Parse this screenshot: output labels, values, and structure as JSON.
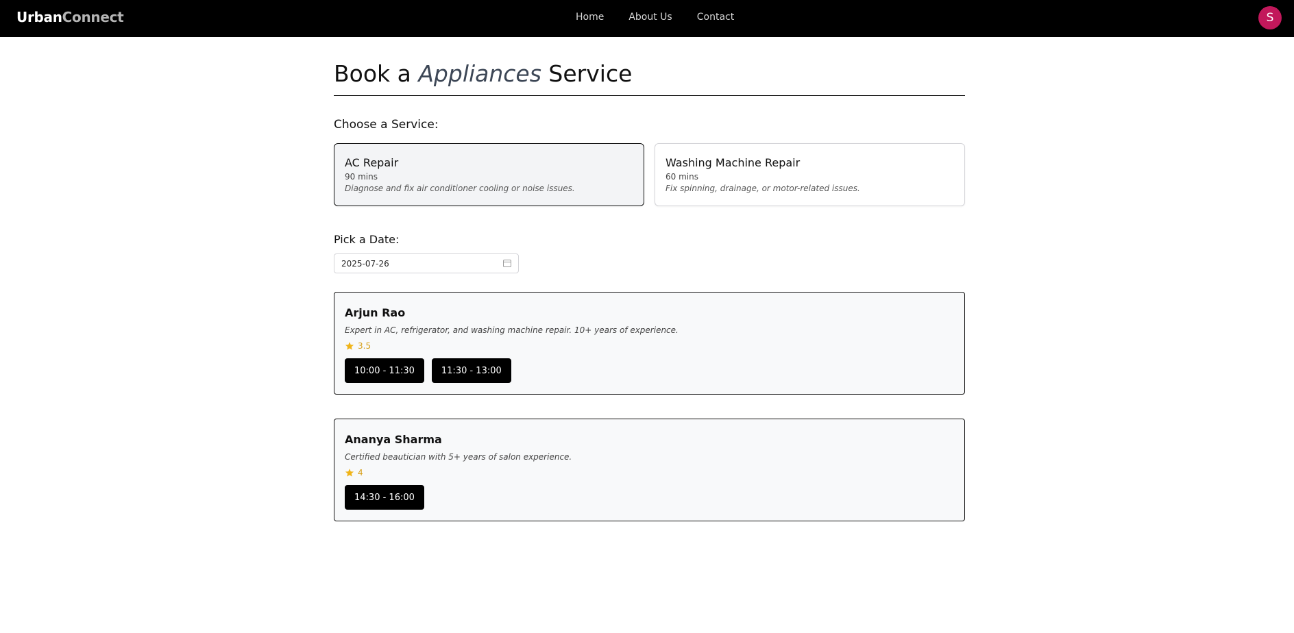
{
  "navbar": {
    "brand_part1": "Urban",
    "brand_part2": "Connect",
    "links": [
      "Home",
      "About Us",
      "Contact"
    ],
    "avatar_initial": "S",
    "avatar_color": "#c2185b"
  },
  "page": {
    "title_prefix": "Book a ",
    "title_category": "Appliances",
    "title_suffix": " Service",
    "choose_label": "Choose a Service:",
    "date_label": "Pick a Date:"
  },
  "services": [
    {
      "name": "AC Repair",
      "duration": "90 mins",
      "description": "Diagnose and fix air conditioner cooling or noise issues.",
      "selected": true
    },
    {
      "name": "Washing Machine Repair",
      "duration": "60 mins",
      "description": "Fix spinning, drainage, or motor-related issues.",
      "selected": false
    }
  ],
  "date": {
    "value": "2025-07-26",
    "icon": "calendar-icon"
  },
  "professionals": [
    {
      "name": "Arjun Rao",
      "bio": "Expert in AC, refrigerator, and washing machine repair. 10+ years of experience.",
      "rating": "3.5",
      "slots": [
        "10:00 - 11:30",
        "11:30 - 13:00"
      ]
    },
    {
      "name": "Ananya Sharma",
      "bio": "Certified beautician with 5+ years of salon experience.",
      "rating": "4",
      "slots": [
        "14:30 - 16:00"
      ]
    }
  ],
  "colors": {
    "star": "#f0b418",
    "rating_text": "#d69e16",
    "slot_bg": "#000000"
  }
}
